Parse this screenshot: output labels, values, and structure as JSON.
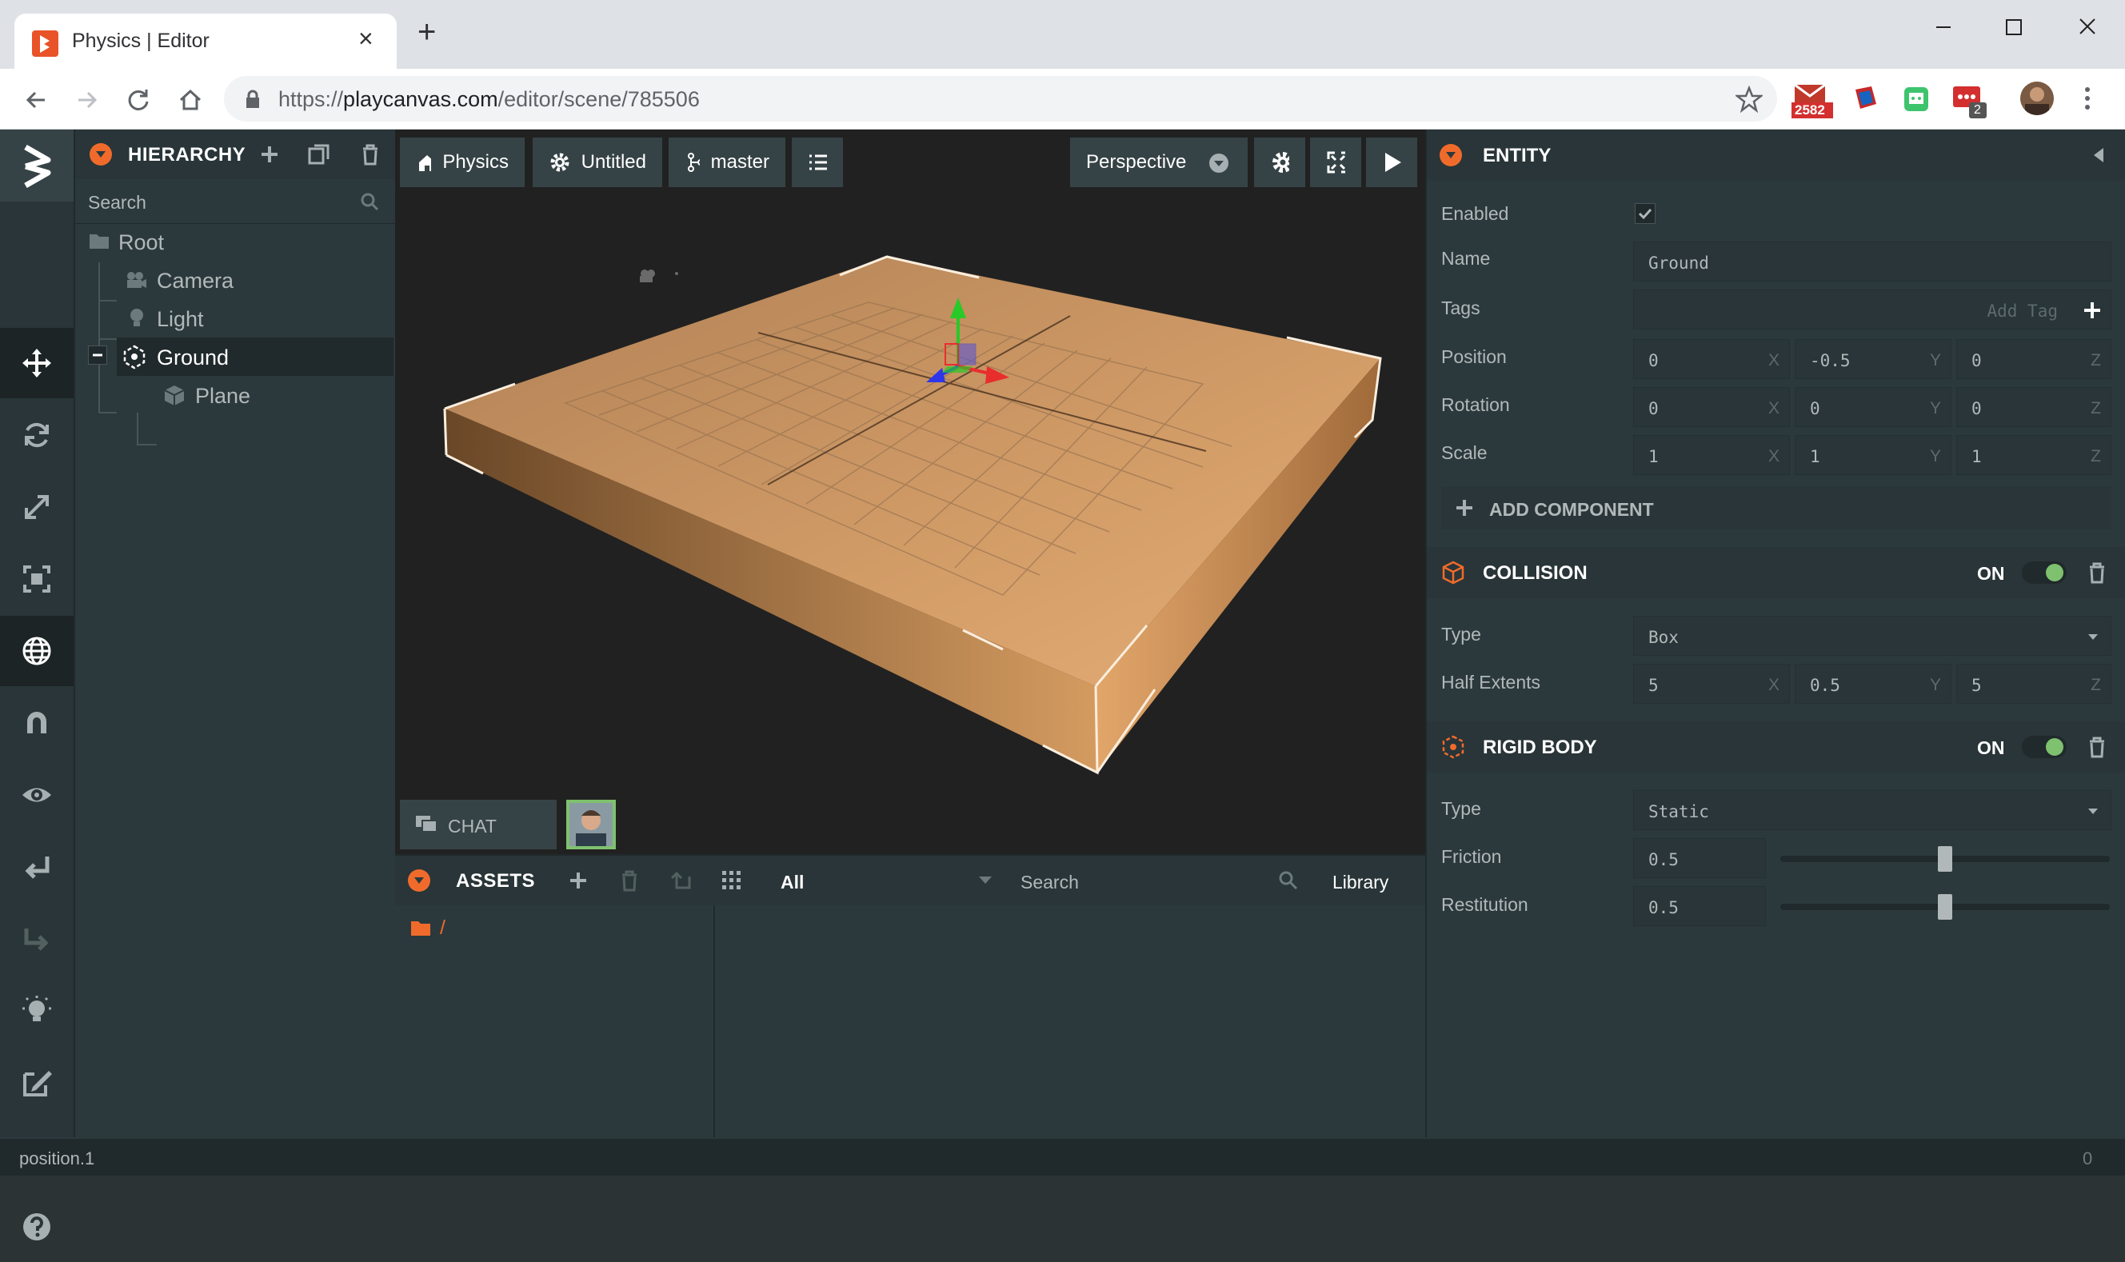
{
  "browser": {
    "tab_title": "Physics | Editor",
    "url_prefix": "https://",
    "url_host": "playcanvas.com",
    "url_path": "/editor/scene/785506",
    "ext_gmail_badge": "2582",
    "ext_chat_badge": "2"
  },
  "hierarchy": {
    "title": "HIERARCHY",
    "search_placeholder": "Search",
    "items": [
      {
        "label": "Root"
      },
      {
        "label": "Camera"
      },
      {
        "label": "Light"
      },
      {
        "label": "Ground"
      },
      {
        "label": "Plane"
      }
    ]
  },
  "viewport": {
    "project": "Physics",
    "scene": "Untitled",
    "branch": "master",
    "camera": "Perspective",
    "chat_label": "CHAT"
  },
  "assets": {
    "title": "ASSETS",
    "filter": "All",
    "search_placeholder": "Search",
    "library": "Library",
    "root_folder": "/"
  },
  "inspector": {
    "entity_title": "ENTITY",
    "enabled_label": "Enabled",
    "name_label": "Name",
    "name_value": "Ground",
    "tags_label": "Tags",
    "add_tag": "Add Tag",
    "position_label": "Position",
    "position": [
      "0",
      "-0.5",
      "0"
    ],
    "rotation_label": "Rotation",
    "rotation": [
      "0",
      "0",
      "0"
    ],
    "scale_label": "Scale",
    "scale": [
      "1",
      "1",
      "1"
    ],
    "axes": [
      "X",
      "Y",
      "Z"
    ],
    "add_component": "ADD COMPONENT",
    "collision": {
      "title": "COLLISION",
      "state": "ON",
      "type_label": "Type",
      "type_value": "Box",
      "half_extents_label": "Half Extents",
      "half_extents": [
        "5",
        "0.5",
        "5"
      ]
    },
    "rigidbody": {
      "title": "RIGID BODY",
      "state": "ON",
      "type_label": "Type",
      "type_value": "Static",
      "friction_label": "Friction",
      "friction_value": "0.5",
      "friction_level": 0.5,
      "restitution_label": "Restitution",
      "restitution_value": "0.5",
      "restitution_level": 0.5
    }
  },
  "status": {
    "left": "position.1",
    "right": "0"
  },
  "colors": {
    "accent": "#f06b2b",
    "panel": "#2c393c",
    "toggle_on": "#7ec16e"
  }
}
